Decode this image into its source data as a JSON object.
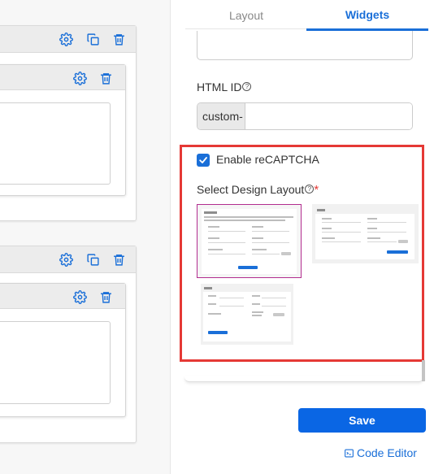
{
  "tabs": [
    {
      "label": "Layout",
      "active": false
    },
    {
      "label": "Widgets",
      "active": true
    }
  ],
  "fields": {
    "html_id_label": "HTML ID",
    "html_id_help": "?",
    "html_id_prefix": "custom-",
    "html_id_value": "",
    "recaptcha_label": "Enable reCAPTCHA",
    "recaptcha_enabled": true,
    "design_layout_label": "Select Design Layout",
    "design_layout_required": "*"
  },
  "layouts": {
    "selected_index": 0,
    "count": 3
  },
  "actions": {
    "save_label": "Save",
    "code_editor_label": "Code Editor"
  },
  "icons": [
    "gear-icon",
    "copy-icon",
    "trash-icon",
    "check-icon",
    "terminal-icon"
  ],
  "colors": {
    "accent": "#1a6fd8",
    "save_button": "#0a66e4",
    "highlight_frame": "#e53935",
    "selected_thumb": "#b22d8f",
    "card_header": "#ececec"
  }
}
